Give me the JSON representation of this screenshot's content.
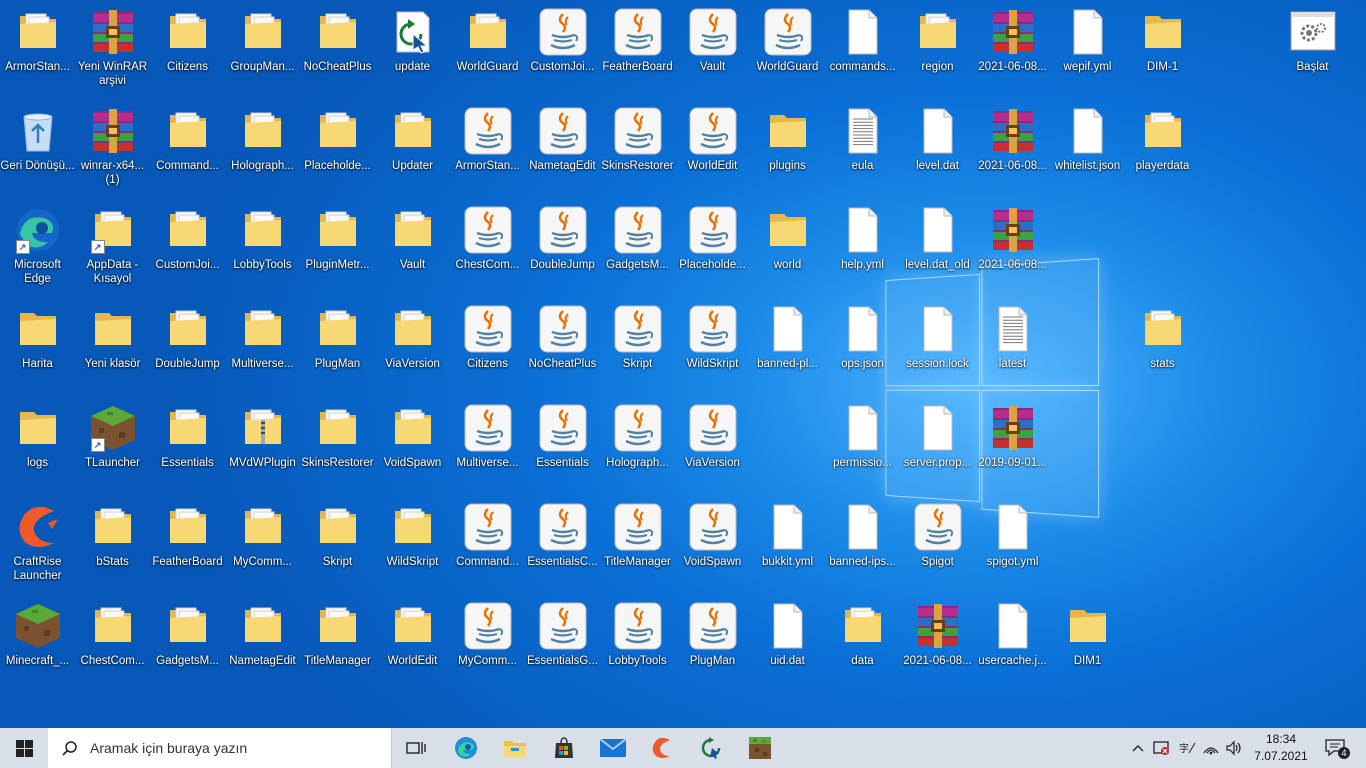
{
  "desktop": {
    "icons": [
      {
        "label": "ArmorStan...",
        "type": "folder",
        "col": 0,
        "row": 0
      },
      {
        "label": "Yeni WinRAR arşivi",
        "type": "winrar",
        "col": 1,
        "row": 0
      },
      {
        "label": "Citizens",
        "type": "folder",
        "col": 2,
        "row": 0
      },
      {
        "label": "GroupMan...",
        "type": "folder",
        "col": 3,
        "row": 0
      },
      {
        "label": "NoCheatPlus",
        "type": "folder",
        "col": 4,
        "row": 0
      },
      {
        "label": "update",
        "type": "update",
        "col": 5,
        "row": 0
      },
      {
        "label": "WorldGuard",
        "type": "folder",
        "col": 6,
        "row": 0
      },
      {
        "label": "CustomJoi...",
        "type": "java",
        "col": 7,
        "row": 0
      },
      {
        "label": "FeatherBoard",
        "type": "java",
        "col": 8,
        "row": 0
      },
      {
        "label": "Vault",
        "type": "java",
        "col": 9,
        "row": 0
      },
      {
        "label": "WorldGuard",
        "type": "java",
        "col": 10,
        "row": 0
      },
      {
        "label": "commands...",
        "type": "file",
        "col": 11,
        "row": 0
      },
      {
        "label": "region",
        "type": "folder",
        "col": 12,
        "row": 0
      },
      {
        "label": "2021-06-08...",
        "type": "winrar",
        "col": 13,
        "row": 0
      },
      {
        "label": "wepif.yml",
        "type": "file",
        "col": 14,
        "row": 0
      },
      {
        "label": "DIM-1",
        "type": "folder-plain",
        "col": 15,
        "row": 0
      },
      {
        "label": "Başlat",
        "type": "settings",
        "col": 17,
        "row": 0
      },
      {
        "label": "Geri Dönüşü...",
        "type": "recycle",
        "col": 0,
        "row": 1
      },
      {
        "label": "winrar-x64... (1)",
        "type": "winrar-setup",
        "col": 1,
        "row": 1
      },
      {
        "label": "Command...",
        "type": "folder",
        "col": 2,
        "row": 1
      },
      {
        "label": "Holograph...",
        "type": "folder",
        "col": 3,
        "row": 1
      },
      {
        "label": "Placeholde...",
        "type": "folder",
        "col": 4,
        "row": 1
      },
      {
        "label": "Updater",
        "type": "folder",
        "col": 5,
        "row": 1
      },
      {
        "label": "ArmorStan...",
        "type": "java",
        "col": 6,
        "row": 1
      },
      {
        "label": "NametagEdit",
        "type": "java",
        "col": 7,
        "row": 1
      },
      {
        "label": "SkinsRestorer",
        "type": "java",
        "col": 8,
        "row": 1
      },
      {
        "label": "WorldEdit",
        "type": "java",
        "col": 9,
        "row": 1
      },
      {
        "label": "plugins",
        "type": "folder-plain",
        "col": 10,
        "row": 1
      },
      {
        "label": "eula",
        "type": "text",
        "col": 11,
        "row": 1
      },
      {
        "label": "level.dat",
        "type": "file",
        "col": 12,
        "row": 1
      },
      {
        "label": "2021-06-08...",
        "type": "winrar",
        "col": 13,
        "row": 1
      },
      {
        "label": "whitelist.json",
        "type": "file",
        "col": 14,
        "row": 1
      },
      {
        "label": "playerdata",
        "type": "folder",
        "col": 15,
        "row": 1
      },
      {
        "label": "Microsoft Edge",
        "type": "edge",
        "col": 0,
        "row": 2
      },
      {
        "label": "AppData - Kısayol",
        "type": "folder-shortcut",
        "col": 1,
        "row": 2
      },
      {
        "label": "CustomJoi...",
        "type": "folder",
        "col": 2,
        "row": 2
      },
      {
        "label": "LobbyTools",
        "type": "folder",
        "col": 3,
        "row": 2
      },
      {
        "label": "PluginMetr...",
        "type": "folder",
        "col": 4,
        "row": 2
      },
      {
        "label": "Vault",
        "type": "folder",
        "col": 5,
        "row": 2
      },
      {
        "label": "ChestCom...",
        "type": "java",
        "col": 6,
        "row": 2
      },
      {
        "label": "DoubleJump",
        "type": "java",
        "col": 7,
        "row": 2
      },
      {
        "label": "GadgetsM...",
        "type": "java",
        "col": 8,
        "row": 2
      },
      {
        "label": "Placeholde...",
        "type": "java",
        "col": 9,
        "row": 2
      },
      {
        "label": "world",
        "type": "folder-plain",
        "col": 10,
        "row": 2
      },
      {
        "label": "help.yml",
        "type": "file",
        "col": 11,
        "row": 2
      },
      {
        "label": "level.dat_old",
        "type": "file",
        "col": 12,
        "row": 2
      },
      {
        "label": "2021-06-08...",
        "type": "winrar",
        "col": 13,
        "row": 2
      },
      {
        "label": "Harita",
        "type": "folder-plain",
        "col": 0,
        "row": 3
      },
      {
        "label": "Yeni klasör",
        "type": "folder-plain",
        "col": 1,
        "row": 3
      },
      {
        "label": "DoubleJump",
        "type": "folder",
        "col": 2,
        "row": 3
      },
      {
        "label": "Multiverse...",
        "type": "folder",
        "col": 3,
        "row": 3
      },
      {
        "label": "PlugMan",
        "type": "folder",
        "col": 4,
        "row": 3
      },
      {
        "label": "ViaVersion",
        "type": "folder",
        "col": 5,
        "row": 3
      },
      {
        "label": "Citizens",
        "type": "java",
        "col": 6,
        "row": 3
      },
      {
        "label": "NoCheatPlus",
        "type": "java",
        "col": 7,
        "row": 3
      },
      {
        "label": "Skript",
        "type": "java",
        "col": 8,
        "row": 3
      },
      {
        "label": "WildSkript",
        "type": "java",
        "col": 9,
        "row": 3
      },
      {
        "label": "banned-pl...",
        "type": "file",
        "col": 10,
        "row": 3
      },
      {
        "label": "ops.json",
        "type": "file",
        "col": 11,
        "row": 3
      },
      {
        "label": "session.lock",
        "type": "file",
        "col": 12,
        "row": 3
      },
      {
        "label": "latest",
        "type": "text",
        "col": 13,
        "row": 3
      },
      {
        "label": "stats",
        "type": "folder",
        "col": 15,
        "row": 3
      },
      {
        "label": "logs",
        "type": "folder-plain",
        "col": 0,
        "row": 4
      },
      {
        "label": "TLauncher",
        "type": "minecraft-shortcut",
        "col": 1,
        "row": 4
      },
      {
        "label": "Essentials",
        "type": "folder",
        "col": 2,
        "row": 4
      },
      {
        "label": "MVdWPlugin",
        "type": "folder-zip",
        "col": 3,
        "row": 4
      },
      {
        "label": "SkinsRestorer",
        "type": "folder",
        "col": 4,
        "row": 4
      },
      {
        "label": "VoidSpawn",
        "type": "folder",
        "col": 5,
        "row": 4
      },
      {
        "label": "Multiverse...",
        "type": "java",
        "col": 6,
        "row": 4
      },
      {
        "label": "Essentials",
        "type": "java",
        "col": 7,
        "row": 4
      },
      {
        "label": "Holograph...",
        "type": "java",
        "col": 8,
        "row": 4
      },
      {
        "label": "ViaVersion",
        "type": "java",
        "col": 9,
        "row": 4
      },
      {
        "label": "permissio...",
        "type": "file",
        "col": 11,
        "row": 4
      },
      {
        "label": "server.prop...",
        "type": "file",
        "col": 12,
        "row": 4
      },
      {
        "label": "2019-09-01...",
        "type": "winrar",
        "col": 13,
        "row": 4
      },
      {
        "label": "CraftRise Launcher",
        "type": "craftrise",
        "col": 0,
        "row": 5
      },
      {
        "label": "bStats",
        "type": "folder",
        "col": 1,
        "row": 5
      },
      {
        "label": "FeatherBoard",
        "type": "folder",
        "col": 2,
        "row": 5
      },
      {
        "label": "MyComm...",
        "type": "folder",
        "col": 3,
        "row": 5
      },
      {
        "label": "Skript",
        "type": "folder",
        "col": 4,
        "row": 5
      },
      {
        "label": "WildSkript",
        "type": "folder",
        "col": 5,
        "row": 5
      },
      {
        "label": "Command...",
        "type": "java",
        "col": 6,
        "row": 5
      },
      {
        "label": "EssentialsC...",
        "type": "java",
        "col": 7,
        "row": 5
      },
      {
        "label": "TitleManager",
        "type": "java",
        "col": 8,
        "row": 5
      },
      {
        "label": "VoidSpawn",
        "type": "java",
        "col": 9,
        "row": 5
      },
      {
        "label": "bukkit.yml",
        "type": "file",
        "col": 10,
        "row": 5
      },
      {
        "label": "banned-ips...",
        "type": "file",
        "col": 11,
        "row": 5
      },
      {
        "label": "Spigot",
        "type": "java",
        "col": 12,
        "row": 5
      },
      {
        "label": "spigot.yml",
        "type": "file",
        "col": 13,
        "row": 5
      },
      {
        "label": "Minecraft_...",
        "type": "minecraft",
        "col": 0,
        "row": 6
      },
      {
        "label": "ChestCom...",
        "type": "folder",
        "col": 1,
        "row": 6
      },
      {
        "label": "GadgetsM...",
        "type": "folder",
        "col": 2,
        "row": 6
      },
      {
        "label": "NametagEdit",
        "type": "folder",
        "col": 3,
        "row": 6
      },
      {
        "label": "TitleManager",
        "type": "folder",
        "col": 4,
        "row": 6
      },
      {
        "label": "WorldEdit",
        "type": "folder",
        "col": 5,
        "row": 6
      },
      {
        "label": "MyComm...",
        "type": "java",
        "col": 6,
        "row": 6
      },
      {
        "label": "EssentialsG...",
        "type": "java",
        "col": 7,
        "row": 6
      },
      {
        "label": "LobbyTools",
        "type": "java",
        "col": 8,
        "row": 6
      },
      {
        "label": "PlugMan",
        "type": "java",
        "col": 9,
        "row": 6
      },
      {
        "label": "uid.dat",
        "type": "file",
        "col": 10,
        "row": 6
      },
      {
        "label": "data",
        "type": "folder",
        "col": 11,
        "row": 6
      },
      {
        "label": "2021-06-08...",
        "type": "winrar",
        "col": 12,
        "row": 6
      },
      {
        "label": "usercache.j...",
        "type": "file",
        "col": 13,
        "row": 6
      },
      {
        "label": "DIM1",
        "type": "folder-plain",
        "col": 14,
        "row": 6
      }
    ]
  },
  "taskbar": {
    "search_placeholder": "Aramak için buraya yazın",
    "pinned": [
      "start-icon",
      "search-icon",
      "task-view-icon",
      "edge-icon",
      "file-explorer-icon",
      "store-icon",
      "mail-icon",
      "craftrise-icon",
      "update-icon",
      "minecraft-icon"
    ],
    "tray": {
      "time": "18:34",
      "date": "7.07.2021",
      "notifications_count": "4",
      "lang_label": "TR"
    }
  },
  "colors": {
    "folder": "#f8d775",
    "folder_dark": "#e4b84b",
    "taskbar_bg": "#d9dfe8",
    "java_red": "#e76f00",
    "java_blue": "#5382a1",
    "winrar_purple": "#8b2b7a"
  }
}
